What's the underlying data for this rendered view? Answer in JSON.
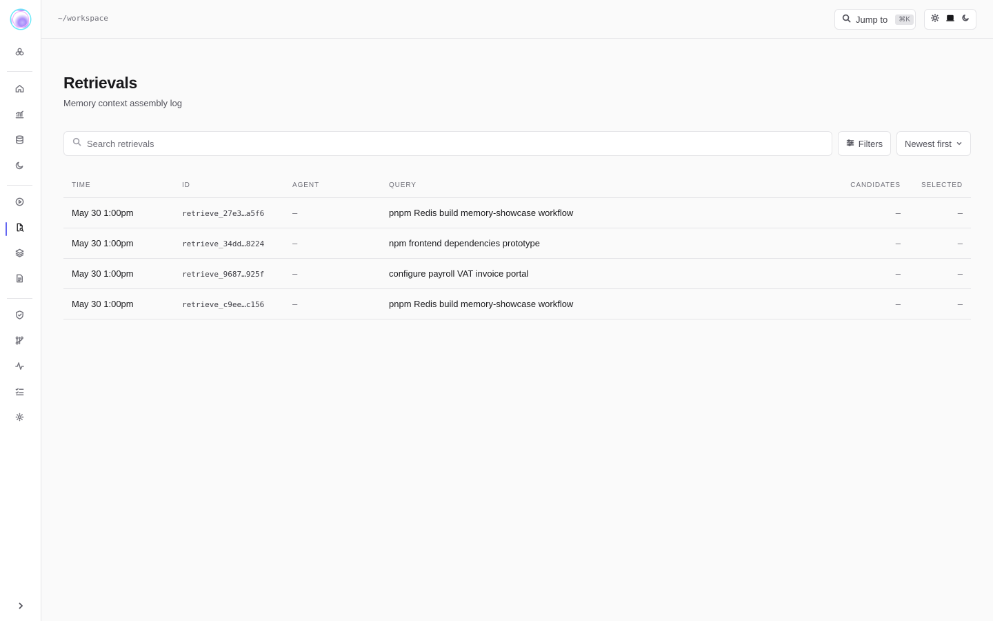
{
  "topbar": {
    "breadcrumb": "~/workspace",
    "jump_label": "Jump to",
    "jump_shortcut": "⌘K"
  },
  "sidebar": {
    "items": [
      {
        "icon": "brain-icon"
      },
      {
        "icon": "home-icon"
      },
      {
        "icon": "chart-icon"
      },
      {
        "icon": "database-icon"
      },
      {
        "icon": "moon-icon"
      },
      {
        "icon": "play-icon"
      },
      {
        "icon": "file-search-icon",
        "active": true
      },
      {
        "icon": "layers-icon"
      },
      {
        "icon": "document-icon"
      },
      {
        "icon": "shield-icon"
      },
      {
        "icon": "git-icon"
      },
      {
        "icon": "activity-icon"
      },
      {
        "icon": "list-check-icon"
      },
      {
        "icon": "settings-icon"
      }
    ],
    "accent": "#6366f1"
  },
  "page": {
    "title": "Retrievals",
    "subtitle": "Memory context assembly log"
  },
  "toolbar": {
    "search_placeholder": "Search retrievals",
    "filters_label": "Filters",
    "sort_label": "Newest first"
  },
  "table": {
    "headers": {
      "time": "TIME",
      "id": "ID",
      "agent": "AGENT",
      "query": "QUERY",
      "candidates": "CANDIDATES",
      "selected": "SELECTED"
    },
    "rows": [
      {
        "time": "May 30 1:00pm",
        "id": "retrieve_27e3…a5f6",
        "agent": "–",
        "query": "pnpm Redis build memory-showcase workflow",
        "candidates": "–",
        "selected": "–"
      },
      {
        "time": "May 30 1:00pm",
        "id": "retrieve_34dd…8224",
        "agent": "–",
        "query": "npm frontend dependencies prototype",
        "candidates": "–",
        "selected": "–"
      },
      {
        "time": "May 30 1:00pm",
        "id": "retrieve_9687…925f",
        "agent": "–",
        "query": "configure payroll VAT invoice portal",
        "candidates": "–",
        "selected": "–"
      },
      {
        "time": "May 30 1:00pm",
        "id": "retrieve_c9ee…c156",
        "agent": "–",
        "query": "pnpm Redis build memory-showcase workflow",
        "candidates": "–",
        "selected": "–"
      }
    ]
  }
}
